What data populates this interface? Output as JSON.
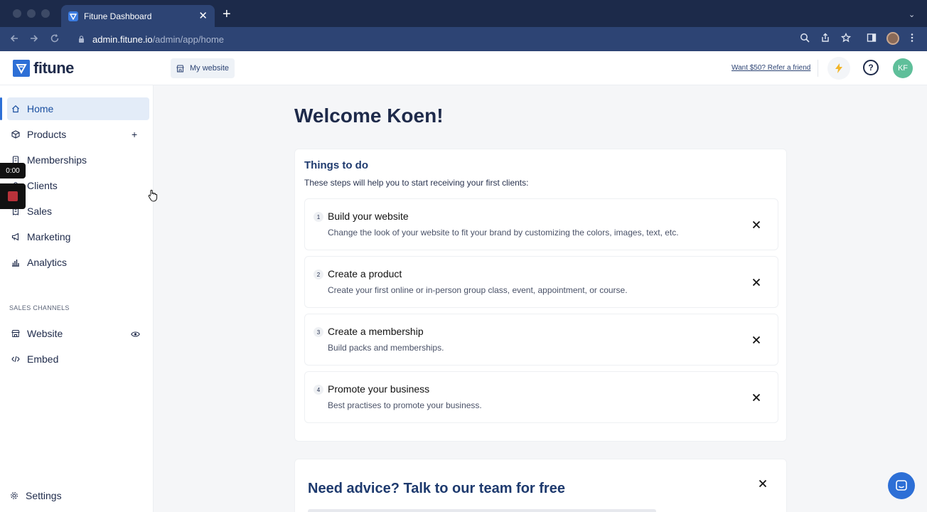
{
  "browser": {
    "tab_title": "Fitune Dashboard",
    "tab_close": "✕",
    "new_tab": "+",
    "tab_menu": "⌄",
    "url_host": "admin.fitune.io",
    "url_path": "/admin/app/home",
    "icons": [
      "back-icon",
      "forward-icon",
      "reload-icon",
      "lock-icon",
      "zoom-icon",
      "share-icon",
      "star-icon",
      "sidebar-icon",
      "profile-icon",
      "more-icon"
    ]
  },
  "header": {
    "logo_text": "fitune",
    "my_website": "My website",
    "refer_link": "Want $50? Refer a friend",
    "help": "?",
    "avatar_initials": "KF",
    "brand_color": "#2d6fd6"
  },
  "sidebar": {
    "items": [
      {
        "label": "Home",
        "icon": "home-icon"
      },
      {
        "label": "Products",
        "icon": "box-icon",
        "trail": "+"
      },
      {
        "label": "Memberships",
        "icon": "card-icon"
      },
      {
        "label": "Clients",
        "icon": "users-icon"
      },
      {
        "label": "Sales",
        "icon": "receipt-icon"
      },
      {
        "label": "Marketing",
        "icon": "megaphone-icon"
      },
      {
        "label": "Analytics",
        "icon": "chart-icon"
      }
    ],
    "section_label": "SALES CHANNELS",
    "channels": [
      {
        "label": "Website",
        "icon": "store-icon",
        "trail_icon": "eye-icon"
      },
      {
        "label": "Embed",
        "icon": "code-icon"
      }
    ],
    "settings": "Settings"
  },
  "recorder": {
    "time": "0:00"
  },
  "main": {
    "welcome": "Welcome Koen!",
    "todo": {
      "title": "Things to do",
      "subtitle": "These steps will help you to start receiving your first clients:",
      "steps": [
        {
          "num": "1",
          "title": "Build your website",
          "desc": "Change the look of your website to fit your brand by customizing the colors, images, text, etc."
        },
        {
          "num": "2",
          "title": "Create a product",
          "desc": "Create your first online or in-person group class, event, appointment, or course."
        },
        {
          "num": "3",
          "title": "Create a membership",
          "desc": "Build packs and memberships."
        },
        {
          "num": "4",
          "title": "Promote your business",
          "desc": "Best practises to promote your business."
        }
      ]
    },
    "advice": {
      "title": "Need advice? Talk to our team for free"
    }
  }
}
